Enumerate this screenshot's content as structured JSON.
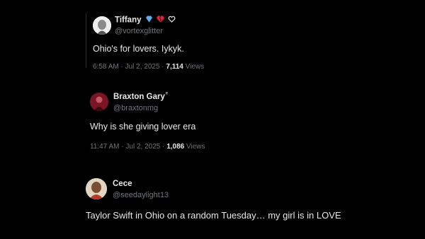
{
  "tweets": [
    {
      "name": "Tiffany",
      "handle": "@vortexglitter",
      "text": "Ohio's for lovers. Iykyk.",
      "time": "6:58 AM · Jul 2, 2025 · ",
      "views_count": "7,114",
      "views_label": " Views",
      "emojis": [
        "gem-heart-icon",
        "broken-heart-icon",
        "heart-hands-icon"
      ]
    },
    {
      "name": "Braxton Gary",
      "name_suffix": "ᶠᶠ",
      "handle": "@braxtonmg",
      "text": "Why is she giving lover era",
      "time": "11:47 AM · Jul 2, 2025 · ",
      "views_count": "1,086",
      "views_label": " Views"
    },
    {
      "name": "Cece",
      "handle": "@seedaylight13",
      "text": "Taylor Swift in Ohio on a random Tuesday… my girl is in LOVE"
    }
  ],
  "colors": {
    "background": "#000000",
    "text": "#e7e9ea",
    "secondary": "#71767b"
  }
}
